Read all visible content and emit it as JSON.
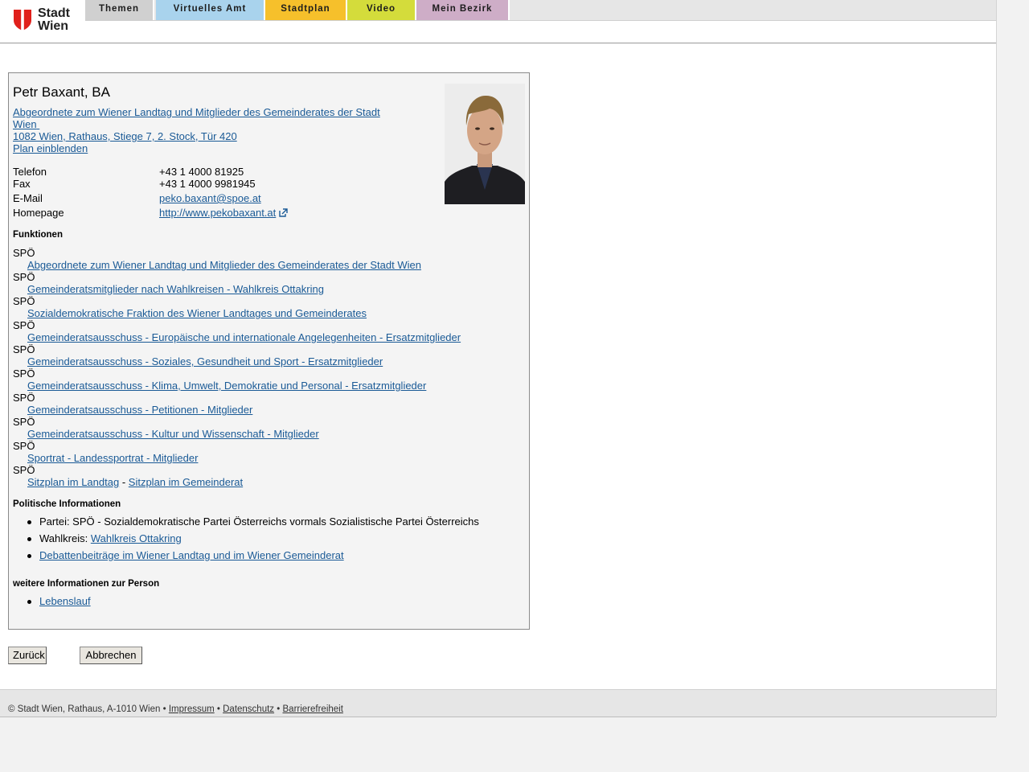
{
  "header": {
    "logo_text": [
      "Stadt",
      "Wien"
    ],
    "nav": [
      "Themen",
      "Virtuelles Amt",
      "Stadtplan",
      "Video",
      "Mein Bezirk"
    ],
    "nav_colors": [
      "#d0d0d0",
      "#a9d3ed",
      "#f6c02b",
      "#d4dc3b",
      "#ceadc7"
    ]
  },
  "person": {
    "name": "Petr Baxant, BA",
    "role_link_1": "Abgeordnete zum Wiener Landtag und Mitglieder des Gemeinderates der Stadt",
    "role_link_2": "Wien",
    "address": "1082 Wien, Rathaus, Stiege 7, 2. Stock, Tür 420",
    "plan_link": "Plan einblenden"
  },
  "contact": {
    "phone_label": "Telefon",
    "phone": "+43 1 4000 81925",
    "fax_label": "Fax",
    "fax": "+43 1 4000 9981945",
    "email_label": "E-Mail",
    "email": "peko.baxant@spoe.at",
    "homepage_label": "Homepage",
    "homepage": "http://www.pekobaxant.at"
  },
  "functions": {
    "heading": "Funktionen",
    "items": [
      {
        "party": "SPÖ",
        "link": "Abgeordnete zum Wiener Landtag und Mitglieder des Gemeinderates der Stadt Wien"
      },
      {
        "party": "SPÖ",
        "link": "Gemeinderatsmitglieder nach Wahlkreisen - Wahlkreis Ottakring"
      },
      {
        "party": "SPÖ",
        "link": "Sozialdemokratische Fraktion des Wiener Landtages und Gemeinderates"
      },
      {
        "party": "SPÖ",
        "link": "Gemeinderatsausschuss - Europäische und internationale Angelegenheiten - Ersatzmitglieder"
      },
      {
        "party": "SPÖ",
        "link": "Gemeinderatsausschuss - Soziales, Gesundheit und Sport - Ersatzmitglieder"
      },
      {
        "party": "SPÖ",
        "link": "Gemeinderatsausschuss - Klima, Umwelt, Demokratie und Personal - Ersatzmitglieder"
      },
      {
        "party": "SPÖ",
        "link": "Gemeinderatsausschuss - Petitionen - Mitglieder"
      },
      {
        "party": "SPÖ",
        "link": "Gemeinderatsausschuss - Kultur und Wissenschaft - Mitglieder"
      },
      {
        "party": "SPÖ",
        "link": "Sportrat - Landessportrat - Mitglieder"
      }
    ],
    "last_party": "SPÖ",
    "seat_landtag": "Sitzplan im Landtag",
    "seat_sep": "-",
    "seat_gemeinderat": "Sitzplan im Gemeinderat"
  },
  "political": {
    "heading": "Politische Informationen",
    "party_text": "Partei: SPÖ - Sozialdemokratische Partei Österreichs vormals Sozialistische Partei Österreichs",
    "district_label": "Wahlkreis:",
    "district_link": "Wahlkreis Ottakring",
    "debates_link": "Debattenbeiträge im Wiener Landtag und im Wiener Gemeinderat"
  },
  "more": {
    "heading": "weitere Informationen zur Person",
    "cv_link": "Lebenslauf"
  },
  "buttons": {
    "back": "Zurück",
    "cancel": "Abbrechen"
  },
  "footer": {
    "copyright": "© Stadt Wien, Rathaus, A-1010 Wien",
    "sep": "•",
    "links": [
      "Impressum",
      "Datenschutz",
      "Barrierefreiheit"
    ]
  }
}
